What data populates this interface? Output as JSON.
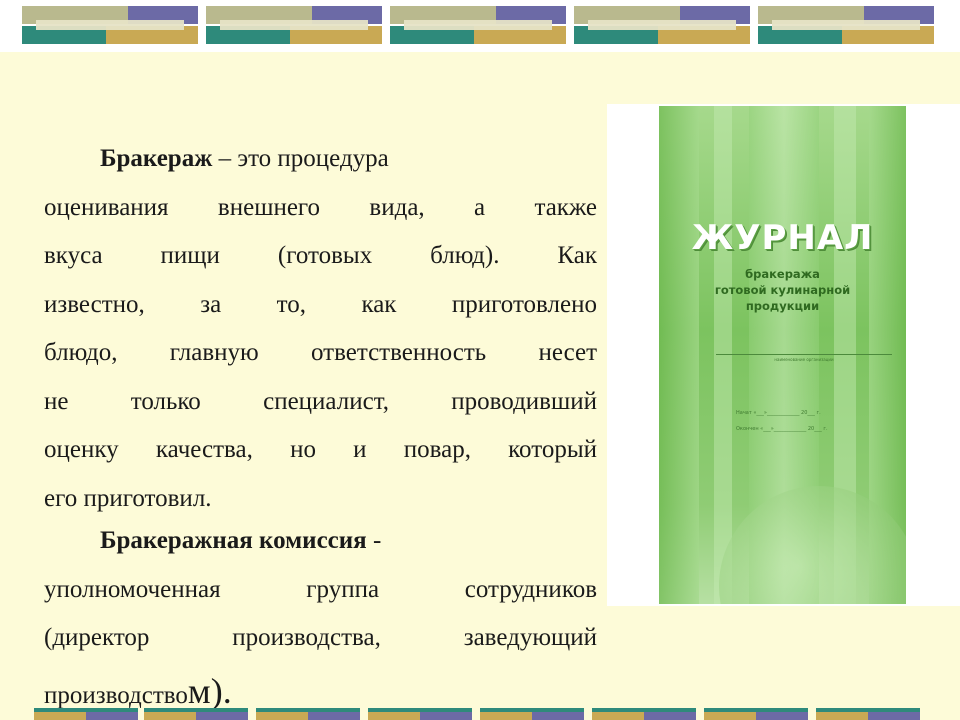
{
  "slide": {
    "paragraph1": {
      "term": "Бракераж",
      "line1_rest": [
        "–",
        "это",
        "процедура"
      ],
      "lines": [
        "оценивания внешнего вида, а также",
        "вкуса пищи (готовых блюд). Как",
        "известно, за то, как приготовлено",
        "блюдо, главную ответственность несет",
        "не только специалист, проводивший",
        "оценку качества, но и повар, который"
      ],
      "last_line": "его приготовил."
    },
    "paragraph2": {
      "term1": "Бракеражная",
      "term2": "комиссия",
      "dash": "-",
      "lines": [
        "уполномоченная группа сотрудников",
        "(директор производства, заведующий"
      ],
      "last_line_start": "производство",
      "last_line_big": "м)."
    }
  },
  "cover": {
    "title": "ЖУРНАЛ",
    "subtitle_lines": [
      "бракеража",
      "готовой кулинарной",
      "продукции"
    ],
    "org_caption": "наименование организации",
    "start_field": "Начат «___»_____________ 20___ г.",
    "end_field": "Окончен «___»_____________ 20___ г."
  },
  "colors": {
    "background": "#fdfbd8",
    "decor_olive": "#b9b98e",
    "decor_purple": "#6c6aa6",
    "decor_teal": "#2e8a7b",
    "decor_gold": "#c9a954",
    "cover_green": "#7cc35f"
  }
}
